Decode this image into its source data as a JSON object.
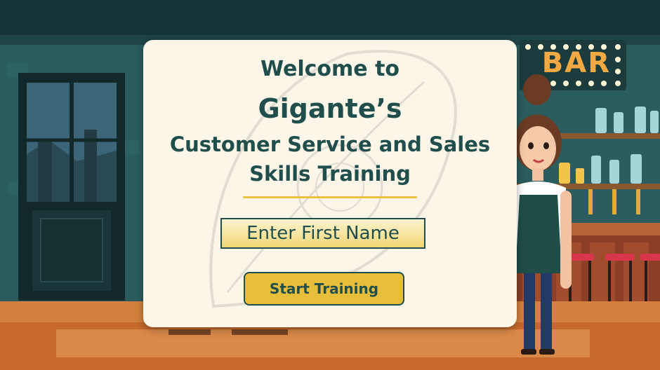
{
  "welcome": {
    "line1": "Welcome to",
    "line2": "Gigante’s",
    "line3": "Customer Service and Sales",
    "line4": "Skills Training"
  },
  "form": {
    "first_name_placeholder": "Enter First Name",
    "start_button_label": "Start Training"
  },
  "background": {
    "bar_sign_text": "BAR"
  },
  "colors": {
    "card_background": "#fbf6e8",
    "title_text": "#1f4e4c",
    "accent_gold": "#e7be3a",
    "scene_teal": "#1f4a4c"
  }
}
